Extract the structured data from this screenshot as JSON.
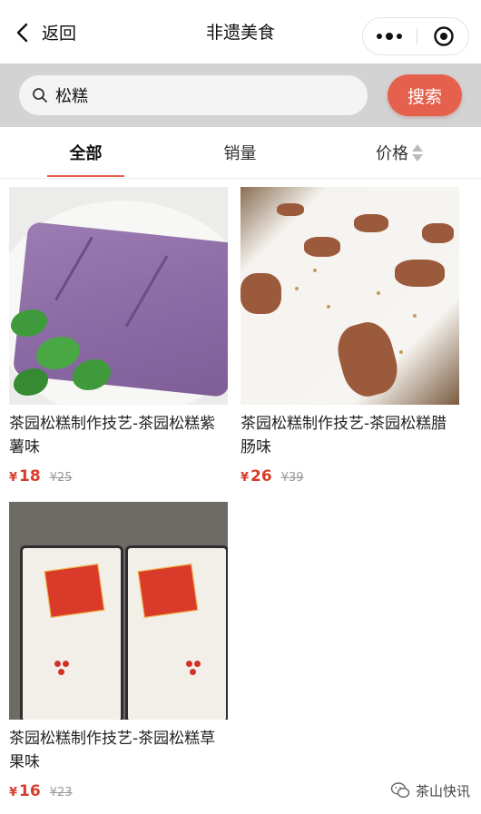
{
  "nav": {
    "back_label": "返回",
    "title": "非遗美食"
  },
  "search": {
    "query": "松糕",
    "button_label": "搜索"
  },
  "tabs": [
    {
      "label": "全部",
      "active": true
    },
    {
      "label": "销量",
      "active": false
    },
    {
      "label": "价格",
      "active": false
    }
  ],
  "products": [
    {
      "title": "茶园松糕制作技艺-茶园松糕紫薯味",
      "currency": "¥",
      "price": "18",
      "old_price": "¥25"
    },
    {
      "title": "茶园松糕制作技艺-茶园松糕腊肠味",
      "currency": "¥",
      "price": "26",
      "old_price": "¥39"
    },
    {
      "title": "茶园松糕制作技艺-茶园松糕草果味",
      "currency": "¥",
      "price": "16",
      "old_price": "¥23"
    }
  ],
  "watermark": "茶山快讯",
  "colors": {
    "accent": "#e5614e",
    "price": "#d63c2c",
    "search_bar_bg": "#d3d3d3"
  },
  "icons": [
    "chevron-left-icon",
    "more-dots-icon",
    "close-circle-icon",
    "search-icon",
    "sort-arrows-icon",
    "wechat-icon"
  ]
}
